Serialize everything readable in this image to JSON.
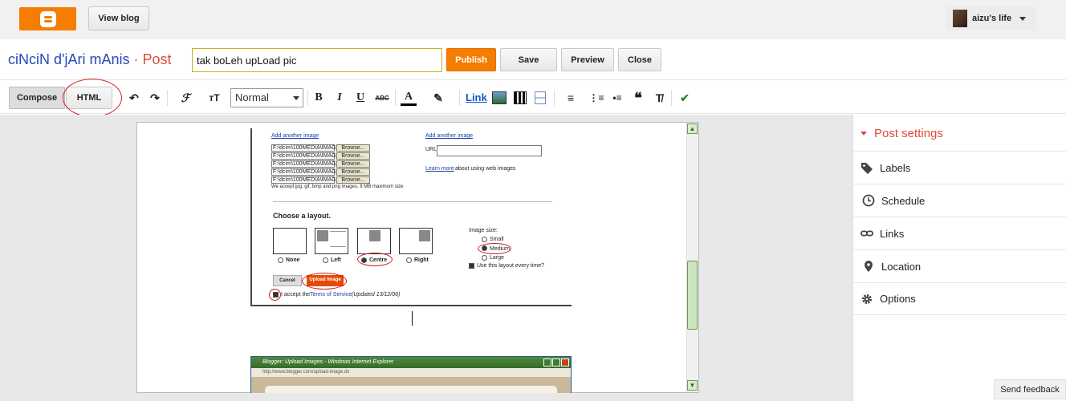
{
  "header": {
    "view_blog": "View blog",
    "user_name": "aizu's life"
  },
  "post": {
    "blog_name": "ciNciN d'jAri mAnis",
    "separator": "·",
    "section": "Post",
    "title_value": "tak boLeh upLoad pic"
  },
  "actions": {
    "publish": "Publish",
    "save": "Save",
    "preview": "Preview",
    "close": "Close"
  },
  "toolbar": {
    "compose": "Compose",
    "html": "HTML",
    "format": "Normal",
    "link": "Link",
    "undo_icon": "↶",
    "redo_icon": "↷",
    "font_icon": "ℱ",
    "size_icon": "тT",
    "bold": "B",
    "italic": "I",
    "underline": "U",
    "strike": "ABC",
    "color_icon": "A",
    "highlight_icon": "✎",
    "align_icon": "≡",
    "numbered_icon": "⋮≡",
    "bullet_icon": "•≡",
    "quote_icon": "❝",
    "clear_icon": "T̸",
    "spell_icon": "✔"
  },
  "upload_dialog": {
    "add_another": "Add another image",
    "files": [
      "F:\\dcim\\100MEDIA\\IMAG",
      "F:\\dcim\\100MEDIA\\IMAG",
      "F:\\dcim\\100MEDIA\\IMAG",
      "F:\\dcim\\100MEDIA\\IMAG",
      "F:\\dcim\\100MEDIA\\IMAG"
    ],
    "browse": "Browse...",
    "accept_note": "We accept jpg, gif, bmp and png images, 8 MB maximum size",
    "url_label": "URL",
    "learn_more": "Learn more",
    "web_images": "about using web images",
    "choose_layout": "Choose a layout.",
    "layouts": [
      "None",
      "Left",
      "Centre",
      "Right"
    ],
    "image_size": "Image size:",
    "sizes": [
      "Small",
      "Medium",
      "Large"
    ],
    "use_layout": "Use this layout every time?",
    "cancel": "Cancel",
    "upload": "Upload Image",
    "accept": "I accept the",
    "tos": "Terms of Service",
    "updated": "(Updated 13/12/06)"
  },
  "ie_window": {
    "title": "Blogger: Upload Images - Windows Internet Explorer",
    "address": "http://www.blogger.com/upload-image.do"
  },
  "sidebar": {
    "title": "Post settings",
    "items": [
      {
        "label": "Labels",
        "icon": "tag-icon"
      },
      {
        "label": "Schedule",
        "icon": "clock-icon"
      },
      {
        "label": "Links",
        "icon": "link-icon"
      },
      {
        "label": "Location",
        "icon": "pin-icon"
      },
      {
        "label": "Options",
        "icon": "gear-icon"
      }
    ]
  },
  "feedback": "Send feedback",
  "colors": {
    "orange": "#f57d00",
    "blog_blue": "#2848b8",
    "red": "#dd4b39"
  }
}
